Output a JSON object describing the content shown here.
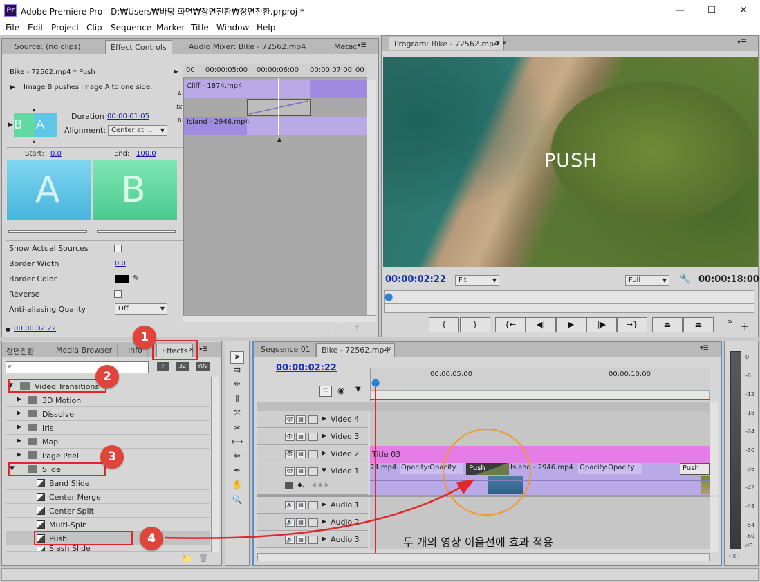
{
  "window": {
    "app_icon": "Pr",
    "title": "Adobe Premiere Pro - D:₩Users₩바탕 화면₩장면전환₩장면전환.prproj *",
    "min_icon": "—",
    "max_icon": "☐",
    "close_icon": "✕"
  },
  "menu": [
    "File",
    "Edit",
    "Project",
    "Clip",
    "Sequence",
    "Marker",
    "Title",
    "Window",
    "Help"
  ],
  "source_panel": {
    "tabs": [
      "Source: (no clips)",
      "Effect Controls",
      "Audio Mixer: Bike - 72562.mp4",
      "Metac"
    ],
    "clip_header": "Bike - 72562.mp4 * Push",
    "description": "Image B pushes image A to one side.",
    "duration_label": "Duration",
    "duration_value": "00:00:01:05",
    "alignment_label": "Alignment:",
    "alignment_value": "Center at ...",
    "start_label": "Start:",
    "start_value": "0.0",
    "end_label": "End:",
    "end_value": "100.0",
    "letter_a": "A",
    "letter_b": "B",
    "thumb_b": "B",
    "thumb_a": "A",
    "side_a": "A",
    "side_b": "B",
    "fx_glyph": "fx",
    "props": [
      {
        "label": "Show Actual Sources"
      },
      {
        "label": "Border Width",
        "value": "0.0"
      },
      {
        "label": "Border Color"
      },
      {
        "label": "Reverse"
      },
      {
        "label": "Anti-aliasing Quality",
        "value": "Off"
      }
    ],
    "timecode": "00:00:02:22",
    "ruler": [
      "00",
      "00:00:05:00",
      "00:00:06:00",
      "00:00:07:00",
      "00"
    ],
    "clip_a": "Cliff - 1874.mp4",
    "clip_b": "Island - 2946.mp4",
    "colors": {
      "a_tile": "#5ec6e6",
      "b_tile": "#63d9a2",
      "clip": "#b9a9e6"
    }
  },
  "program_panel": {
    "tab": "Program: Bike - 72562.mp4",
    "overlay_text": "PUSH",
    "timecode": "00:00:02:22",
    "fit": "Fit",
    "quality": "Full",
    "duration": "00:00:18:00",
    "transport": [
      "{",
      "}",
      "{←",
      "◀|",
      "▶",
      "|▶",
      "→}",
      "",
      ""
    ]
  },
  "effects_panel": {
    "tabs": [
      "장면전환",
      "Media Browser",
      "Info",
      "Effects"
    ],
    "search_placeholder": "",
    "preset_icons": [
      "32",
      "YUV"
    ],
    "tree": [
      {
        "label": "Video Transitions",
        "level": 0,
        "open": true
      },
      {
        "label": "3D Motion",
        "level": 1
      },
      {
        "label": "Dissolve",
        "level": 1
      },
      {
        "label": "Iris",
        "level": 1
      },
      {
        "label": "Map",
        "level": 1
      },
      {
        "label": "Page Peel",
        "level": 1
      },
      {
        "label": "Slide",
        "level": 1,
        "open": true
      },
      {
        "label": "Band Slide",
        "level": 2
      },
      {
        "label": "Center Merge",
        "level": 2
      },
      {
        "label": "Center Split",
        "level": 2
      },
      {
        "label": "Multi-Spin",
        "level": 2
      },
      {
        "label": "Push",
        "level": 2,
        "selected": true
      },
      {
        "label": "Slash Slide",
        "level": 2
      }
    ]
  },
  "timeline": {
    "tabs": [
      "Sequence 01",
      "Bike - 72562.mp4"
    ],
    "timecode": "00:00:02:22",
    "ruler": [
      "00:00:05:00",
      "00:00:10:00"
    ],
    "tracks": [
      "Video 4",
      "Video 3",
      "Video 2",
      "Video 1",
      "Audio 1",
      "Audio 2",
      "Audio 3"
    ],
    "title_clip": "Title 03",
    "clips": [
      "74.mp4",
      "Opacity:Opacity",
      "Push",
      "Island - 2946.mp4",
      "Opacity:Opacity",
      "Push"
    ],
    "caption": "두 개의 영상 이음선에 효과 적용"
  },
  "meter": {
    "ticks": [
      "0",
      "-6",
      "-12",
      "-18",
      "-24",
      "-30",
      "-36",
      "-42",
      "-48",
      "-54",
      "-60",
      "dB"
    ]
  },
  "badges": [
    "1",
    "2",
    "3",
    "4"
  ],
  "accent": {
    "red": "#e0272c",
    "badge": "#e0453c",
    "circle": "#f0982a",
    "blue_link": "#1a1ab8",
    "title_clip": "#e67de6"
  }
}
